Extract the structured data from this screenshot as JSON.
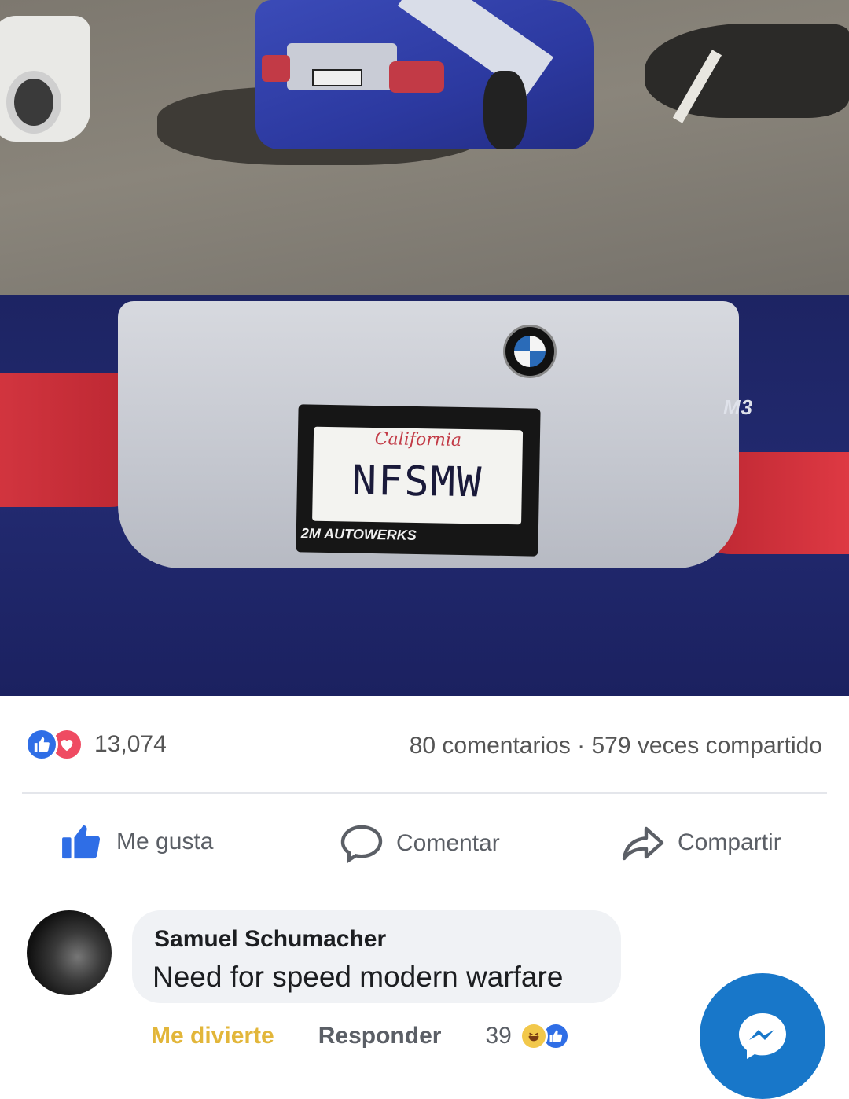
{
  "post": {
    "plate_text": "NFSMW",
    "plate_state": "California",
    "plate_frame_text": "2M AUTOWERKS",
    "badge_text": "M3"
  },
  "stats": {
    "reaction_count": "13,074",
    "comments": "80 comentarios",
    "separator": "·",
    "shares": "579 veces compartido"
  },
  "actions": {
    "like": "Me gusta",
    "comment": "Comentar",
    "share": "Compartir"
  },
  "comment": {
    "author": "Samuel Schumacher",
    "text": "Need for speed modern warfare",
    "reaction_label": "Me divierte",
    "reply_label": "Responder",
    "reaction_count": "39"
  },
  "colors": {
    "like_blue": "#2f6ee6",
    "love_red": "#ef4b62",
    "haha_yellow": "#e2b63a",
    "messenger_blue": "#1877c9"
  },
  "icons": [
    "like-reaction-icon",
    "love-reaction-icon",
    "thumbs-up-icon",
    "comment-icon",
    "share-icon",
    "haha-reaction-icon",
    "messenger-icon"
  ]
}
